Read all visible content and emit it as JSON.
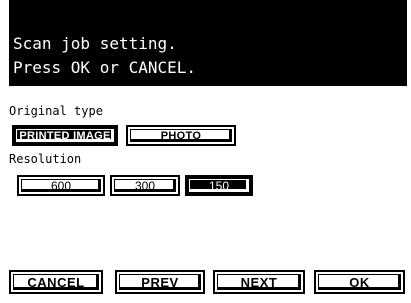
{
  "message": {
    "line1": "Scan job setting.",
    "line2": "Press OK or CANCEL."
  },
  "original_type": {
    "label": "Original type",
    "options": [
      "PRINTED IMAGE",
      "PHOTO"
    ],
    "selected": "PRINTED IMAGE"
  },
  "resolution": {
    "label": "Resolution",
    "options": [
      "600",
      "300",
      "150"
    ],
    "selected": "150"
  },
  "footer": {
    "cancel": "CANCEL",
    "prev": "PREV",
    "next": "NEXT",
    "ok": "OK"
  }
}
